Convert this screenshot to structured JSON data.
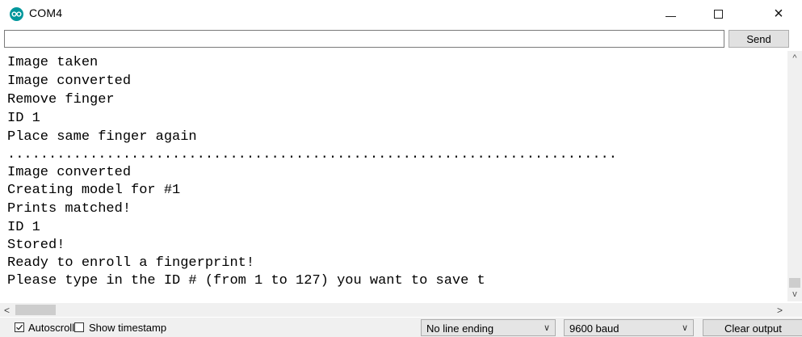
{
  "window": {
    "title": "COM4",
    "app_icon": "arduino-infinity-icon",
    "accent_color": "#00979c",
    "min_symbol": "minimize-icon",
    "max_symbol": "maximize-icon",
    "close_symbol": "×"
  },
  "input": {
    "value": "",
    "placeholder": "",
    "send_label": "Send"
  },
  "output": {
    "lines": [
      "Image taken",
      "Image converted",
      "Remove finger",
      "ID 1",
      "Place same finger again",
      "..........................................................................",
      "Image converted",
      "Creating model for #1",
      "Prints matched!",
      "ID 1",
      "Stored!",
      "Ready to enroll a fingerprint!",
      "Please type in the ID # (from 1 to 127) you want to save t"
    ]
  },
  "scrollbar": {
    "up": "^",
    "down": "v",
    "left": "<",
    "right": ">"
  },
  "bottom": {
    "autoscroll_label": "Autoscroll",
    "autoscroll_checked": true,
    "timestamp_label": "Show timestamp",
    "timestamp_checked": false,
    "line_ending_value": "No line ending",
    "baud_value": "9600 baud",
    "dropdown_arrow": "∨",
    "clear_label": "Clear output"
  }
}
